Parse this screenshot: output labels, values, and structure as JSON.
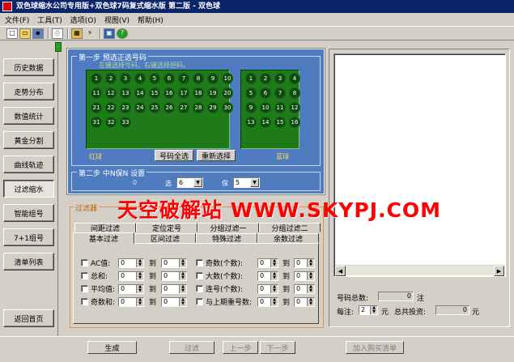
{
  "window": {
    "title": "双色球缩水公司专用版+双色球7码复式缩水版 第二版 - 双色球"
  },
  "menu": [
    "文件(F)",
    "工具(T)",
    "选项(O)",
    "视图(V)",
    "帮助(H)"
  ],
  "nav": [
    "历史数据",
    "走势分布",
    "数值统计",
    "黄金分割",
    "曲线轨迹",
    "过滤缩水",
    "智能组号",
    "7+1组号",
    "清单列表",
    "返回首页"
  ],
  "step1": {
    "label": "第一步 预选正选号码",
    "hint": "左键选择号码，右键选择胆码。",
    "red_label": "红球",
    "blue_label": "蓝球",
    "btn_all": "号码全选",
    "btn_reset": "重新选择"
  },
  "red_balls": [
    "1",
    "2",
    "3",
    "4",
    "5",
    "6",
    "7",
    "8",
    "9",
    "10",
    "11",
    "12",
    "13",
    "14",
    "15",
    "16",
    "17",
    "18",
    "19",
    "20",
    "21",
    "22",
    "23",
    "24",
    "25",
    "26",
    "27",
    "28",
    "29",
    "30",
    "31",
    "32",
    "33"
  ],
  "blue_balls": [
    "1",
    "2",
    "3",
    "4",
    "5",
    "6",
    "7",
    "8",
    "9",
    "10",
    "11",
    "12",
    "13",
    "14",
    "15",
    "16"
  ],
  "step2": {
    "label": "第二步 中N保N 设置",
    "zero": "0",
    "choose_label": "选",
    "choose_value": "6",
    "guarantee_label": "保",
    "guarantee_value": "5"
  },
  "watermark": "天空破解站 WWW.SKYPJ.COM",
  "filter": {
    "label": "过滤器",
    "tabs_row1": [
      "间距过滤",
      "定位定号",
      "分组过滤一",
      "分组过滤二"
    ],
    "tabs_row2": [
      "基本过滤",
      "区间过滤",
      "特殊过滤",
      "余数过滤"
    ],
    "to": "到",
    "left_rows": [
      {
        "label": "AC值:",
        "from": "0",
        "to": "0"
      },
      {
        "label": "总和:",
        "from": "0",
        "to": "0"
      },
      {
        "label": "平均值:",
        "from": "0",
        "to": "0"
      },
      {
        "label": "奇数和:",
        "from": "0",
        "to": "0"
      }
    ],
    "right_rows": [
      {
        "label": "奇数(个数):",
        "from": "0",
        "to": "0"
      },
      {
        "label": "大数(个数):",
        "from": "0",
        "to": "0"
      },
      {
        "label": "连号(个数):",
        "from": "0",
        "to": "0"
      },
      {
        "label": "与上期重号数:",
        "from": "0",
        "to": "0"
      }
    ]
  },
  "summary": {
    "total_label": "号码总数:",
    "total_value": "0",
    "unit_bets": "注",
    "per_bet_label": "每注:",
    "per_bet_value": "2",
    "unit_yuan": "元",
    "invest_label": "总共投资:",
    "invest_value": "0",
    "invest_unit": "元"
  },
  "bottom": {
    "generate": "生成",
    "filter": "过滤",
    "prev": "上一步",
    "next": "下一步",
    "add_cart": "加入购买清单"
  }
}
